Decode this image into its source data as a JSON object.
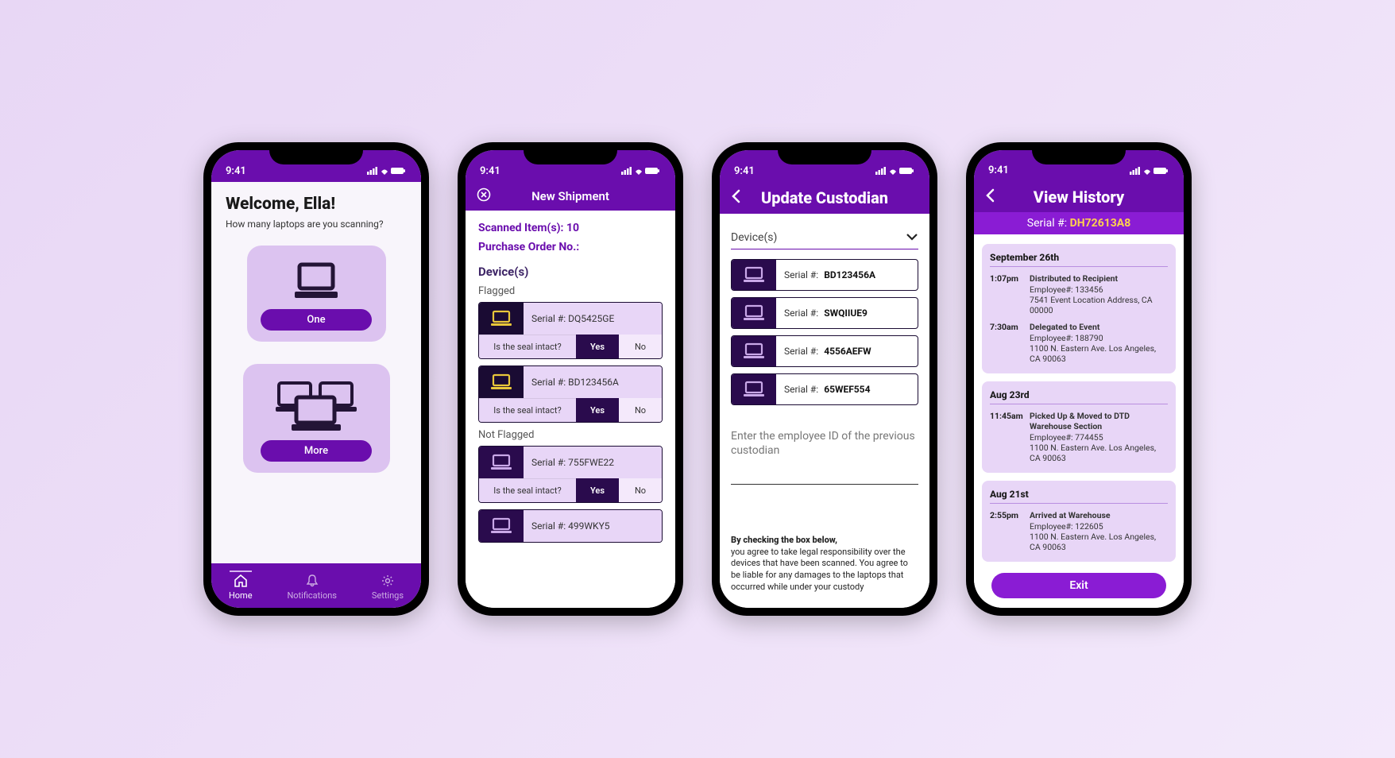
{
  "status": {
    "time": "9:41"
  },
  "screen1": {
    "welcome": "Welcome, Ella!",
    "prompt": "How many laptops are you scanning?",
    "one_label": "One",
    "more_label": "More",
    "nav": {
      "home": "Home",
      "notifications": "Notifications",
      "settings": "Settings"
    }
  },
  "screen2": {
    "title": "New Shipment",
    "scanned_label": "Scanned Item(s): 10",
    "po_label": "Purchase Order No.:",
    "devices_heading": "Device(s)",
    "flagged_label": "Flagged",
    "not_flagged_label": "Not Flagged",
    "seal_q": "Is the seal intact?",
    "yes": "Yes",
    "no": "No",
    "flagged": [
      {
        "serial": "Serial #: DQ5425GE"
      },
      {
        "serial": "Serial #: BD123456A"
      }
    ],
    "not_flagged": [
      {
        "serial": "Serial #: 755FWE22"
      },
      {
        "serial": "Serial #: 499WKY5"
      }
    ]
  },
  "screen3": {
    "title": "Update Custodian",
    "dropdown": "Device(s)",
    "serial_key": "Serial #:",
    "devices": [
      {
        "serial": "BD123456A"
      },
      {
        "serial": "SWQIIUE9"
      },
      {
        "serial": "4556AEFW"
      },
      {
        "serial": "65WEF554"
      }
    ],
    "input_label": "Enter the employee ID of the previous custodian",
    "legal_bold": "By checking the box below,",
    "legal_rest": "you agree to take legal responsibility over the devices that have been scanned. You agree to be liable for any damages to the laptops that occurred while under your custody"
  },
  "screen4": {
    "title": "View History",
    "serial_key": "Serial #:",
    "serial_val": "DH72613A8",
    "groups": [
      {
        "date": "September 26th",
        "entries": [
          {
            "time": "1:07pm",
            "title": "Distributed to Recipient",
            "l1": "Employee#: 133456",
            "l2": "7541 Event Location Address, CA 00000"
          },
          {
            "time": "7:30am",
            "title": "Delegated to Event",
            "l1": "Employee#: 188790",
            "l2": "1100 N. Eastern Ave. Los Angeles, CA 90063"
          }
        ]
      },
      {
        "date": "Aug 23rd",
        "entries": [
          {
            "time": "11:45am",
            "title": "Picked Up & Moved to DTD Warehouse Section",
            "l1": "Employee#: 774455",
            "l2": "1100 N. Eastern Ave. Los Angeles, CA 90063"
          }
        ]
      },
      {
        "date": "Aug 21st",
        "entries": [
          {
            "time": "2:55pm",
            "title": "Arrived at Warehouse",
            "l1": "Employee#: 122605",
            "l2": "1100 N. Eastern Ave. Los Angeles, CA 90063"
          }
        ]
      }
    ],
    "exit": "Exit"
  }
}
